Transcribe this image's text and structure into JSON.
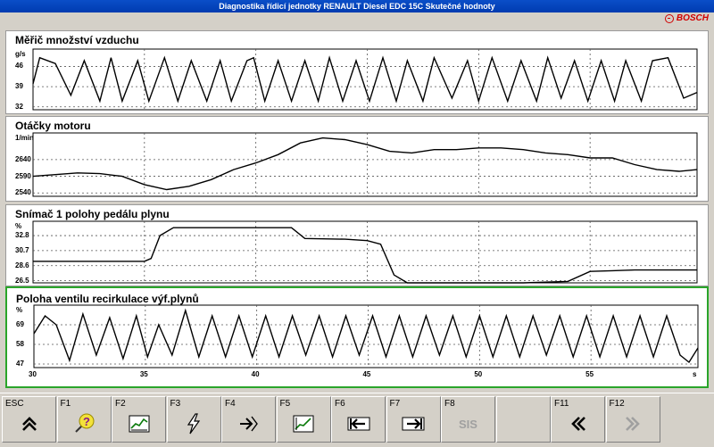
{
  "window": {
    "title": "Diagnostika řídicí jednotky RENAULT Diesel EDC 15C Skutečné hodnoty"
  },
  "brand": {
    "name": "BOSCH"
  },
  "x_axis": {
    "ticks": [
      "30",
      "35",
      "40",
      "45",
      "50",
      "55"
    ],
    "unit": "s",
    "range": [
      30,
      59.8
    ]
  },
  "chart_data": [
    {
      "type": "line",
      "title": "Měřič množství vzduchu",
      "ylabel": "g/s",
      "yticks": [
        "46",
        "39",
        "32"
      ],
      "ylim": [
        31,
        52
      ],
      "x": [
        30,
        30.3,
        31,
        31.7,
        32.3,
        33,
        33.5,
        34,
        34.7,
        35.2,
        35.9,
        36.5,
        37.1,
        37.8,
        38.4,
        38.9,
        39.6,
        39.9,
        40.4,
        41,
        41.6,
        42.2,
        42.8,
        43.3,
        43.9,
        44.5,
        45.1,
        45.7,
        46.3,
        46.8,
        47.5,
        48,
        48.8,
        49.5,
        50,
        50.6,
        51.3,
        51.9,
        52.6,
        53.1,
        53.7,
        54.3,
        54.9,
        55.5,
        56.1,
        56.6,
        57.3,
        57.8,
        58.5,
        59.2,
        59.8
      ],
      "values": [
        40,
        49,
        47,
        36,
        48,
        34,
        49,
        34,
        48,
        34,
        49,
        34,
        48,
        34,
        48,
        34,
        48,
        49,
        34,
        48,
        34,
        48,
        34,
        49,
        34,
        48,
        34,
        49,
        34,
        48,
        34,
        49,
        35,
        48,
        34,
        49,
        34,
        48,
        34,
        49,
        35,
        48,
        34,
        48,
        34,
        48,
        34,
        48,
        49,
        35,
        37
      ]
    },
    {
      "type": "line",
      "title": "Otáčky motoru",
      "ylabel": "1/min",
      "yticks": [
        "2640",
        "2590",
        "2540"
      ],
      "ylim": [
        2530,
        2720
      ],
      "x": [
        30,
        31,
        32,
        33,
        34,
        35,
        36,
        37,
        38,
        39,
        40,
        41,
        42,
        43,
        44,
        45,
        46,
        47,
        48,
        49,
        50,
        51,
        52,
        53,
        54,
        55,
        56,
        57,
        58,
        59,
        59.8
      ],
      "values": [
        2590,
        2595,
        2600,
        2598,
        2590,
        2565,
        2550,
        2560,
        2580,
        2610,
        2630,
        2655,
        2690,
        2705,
        2700,
        2685,
        2665,
        2660,
        2670,
        2670,
        2675,
        2675,
        2670,
        2660,
        2655,
        2645,
        2645,
        2625,
        2610,
        2605,
        2610
      ]
    },
    {
      "type": "line",
      "title": "Snímač 1 polohy pedálu plynu",
      "ylabel": "%",
      "yticks": [
        "32.8",
        "30.7",
        "28.6",
        "26.5"
      ],
      "ylim": [
        26.2,
        34.8
      ],
      "x": [
        30,
        35,
        35.3,
        35.7,
        36.3,
        40,
        41.6,
        42.2,
        44,
        45,
        45.6,
        46.2,
        46.8,
        48,
        50,
        51,
        52,
        53,
        54,
        55,
        56,
        57,
        58,
        59,
        59.8
      ],
      "values": [
        29.2,
        29.2,
        29.6,
        32.8,
        33.9,
        33.9,
        33.9,
        32.4,
        32.3,
        32.1,
        31.6,
        27.3,
        26.2,
        26.2,
        26.2,
        26.2,
        26.2,
        26.3,
        26.4,
        27.8,
        27.9,
        28.0,
        28.0,
        28.0,
        28.0
      ]
    },
    {
      "type": "line",
      "title": "Poloha ventilu recirkulace výf.plynů",
      "ylabel": "%",
      "yticks": [
        "69",
        "58",
        "47"
      ],
      "ylim": [
        45,
        80
      ],
      "x": [
        30,
        30.5,
        31,
        31.6,
        32.2,
        32.8,
        33.4,
        34,
        34.6,
        35.1,
        35.6,
        36.2,
        36.8,
        37.4,
        38,
        38.6,
        39.2,
        39.8,
        40.4,
        41,
        41.6,
        42.2,
        42.8,
        43.4,
        44,
        44.6,
        45.2,
        45.8,
        46.4,
        47,
        47.6,
        48.2,
        48.8,
        49.4,
        50,
        50.6,
        51.2,
        51.8,
        52.4,
        53,
        53.6,
        54.2,
        54.8,
        55.4,
        56,
        56.6,
        57.2,
        57.8,
        58.4,
        59,
        59.4,
        59.8
      ],
      "values": [
        64,
        74,
        69,
        49,
        75,
        52,
        73,
        50,
        74,
        51,
        69,
        52,
        77,
        51,
        74,
        51,
        74,
        51,
        74,
        51,
        74,
        52,
        74,
        51,
        74,
        52,
        74,
        51,
        74,
        51,
        74,
        52,
        74,
        51,
        74,
        51,
        74,
        51,
        74,
        52,
        74,
        51,
        74,
        51,
        74,
        51,
        74,
        51,
        74,
        52,
        48,
        56
      ]
    }
  ],
  "fkeys": [
    {
      "key": "ESC",
      "icon": "double-chevron-up-icon"
    },
    {
      "key": "F1",
      "icon": "help-icon"
    },
    {
      "key": "F2",
      "icon": "graph-icon"
    },
    {
      "key": "F3",
      "icon": "lightning-icon"
    },
    {
      "key": "F4",
      "icon": "enter-arrow-icon"
    },
    {
      "key": "F5",
      "icon": "graph-select-icon"
    },
    {
      "key": "F6",
      "icon": "arrow-left-icon"
    },
    {
      "key": "F7",
      "icon": "arrow-right-icon"
    },
    {
      "key": "F8",
      "icon": "sis-icon",
      "text": "SIS"
    },
    {
      "key": "",
      "icon": ""
    },
    {
      "key": "F11",
      "icon": "double-chevron-left-icon"
    },
    {
      "key": "F12",
      "icon": "double-chevron-right-icon"
    }
  ]
}
